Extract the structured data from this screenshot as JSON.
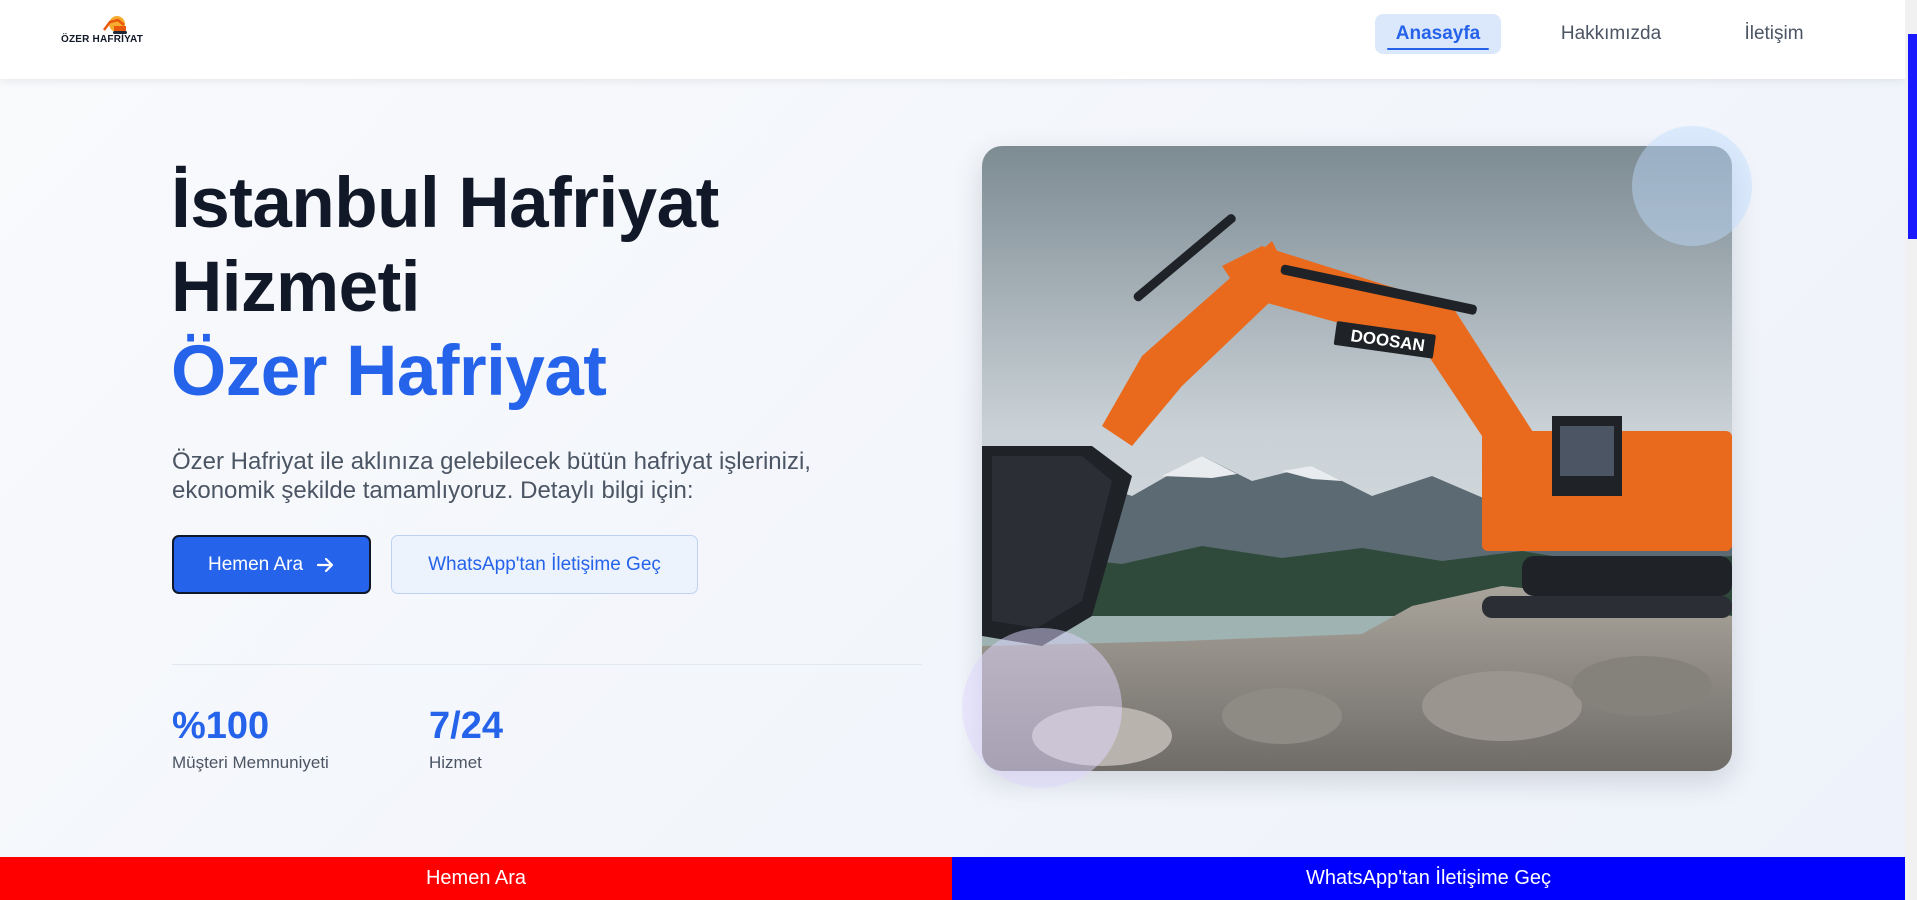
{
  "header": {
    "logo_text": "ÖZER HAFRİYAT",
    "nav": [
      {
        "label": "Anasayfa",
        "active": true
      },
      {
        "label": "Hakkımızda",
        "active": false
      },
      {
        "label": "İletişim",
        "active": false
      }
    ]
  },
  "hero": {
    "title_line1": "İstanbul Hafriyat",
    "title_line2": "Hizmeti",
    "title_brand": "Özer Hafriyat",
    "description": "Özer Hafriyat ile aklınıza gelebilecek bütün hafriyat işlerinizi, ekonomik şekilde tamamlıyoruz. Detaylı bilgi için:",
    "primary_button": "Hemen Ara",
    "secondary_button": "WhatsApp'tan İletişime Geç",
    "stats": [
      {
        "value": "%100",
        "label": "Müşteri Memnuniyeti"
      },
      {
        "value": "7/24",
        "label": "Hizmet"
      }
    ],
    "image_brand_text": "DOOSAN"
  },
  "bottom_bar": {
    "call_label": "Hemen Ara",
    "whatsapp_label": "WhatsApp'tan İletişime Geç"
  },
  "colors": {
    "accent": "#2563eb",
    "call_bar": "#ff0000",
    "whatsapp_bar": "#0000ff"
  }
}
